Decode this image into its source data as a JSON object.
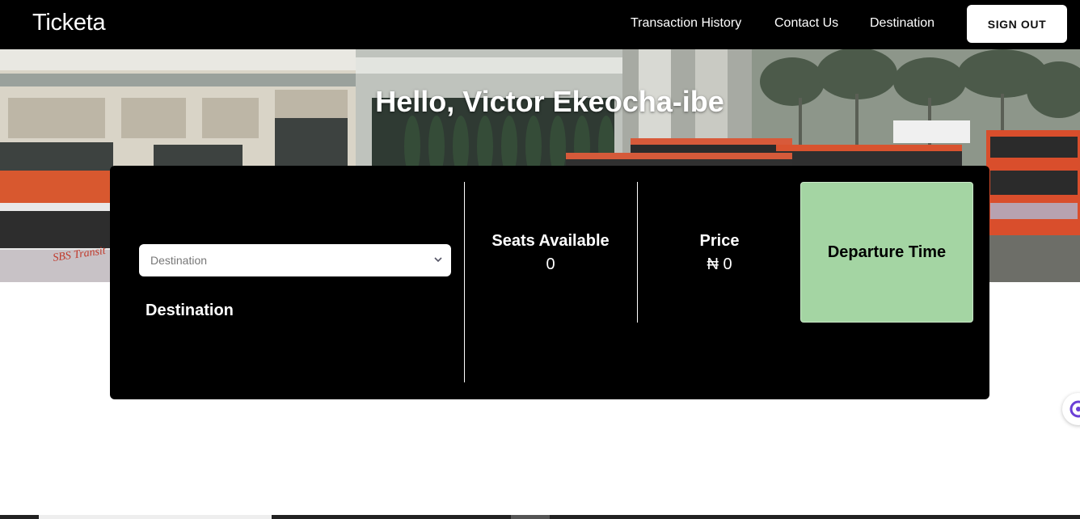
{
  "navbar": {
    "brand": "Ticketa",
    "links": [
      "Transaction History",
      "Contact Us",
      "Destination"
    ],
    "signout_label": "SIGN OUT"
  },
  "hero": {
    "greeting": "Hello, Victor Ekeocha-ibe",
    "bus_sign": "SBS Transit"
  },
  "booking": {
    "destination_select": {
      "placeholder": "Destination"
    },
    "destination_label": "Destination",
    "seats": {
      "title": "Seats Available",
      "value": "0"
    },
    "price": {
      "title": "Price",
      "value": "₦ 0"
    },
    "departure_label": "Departure Time"
  },
  "colors": {
    "navbar": "#000000",
    "card": "#000000",
    "departure_bg": "#a4d5a3"
  },
  "icons": [
    "chevron-down-icon",
    "chat-icon"
  ]
}
